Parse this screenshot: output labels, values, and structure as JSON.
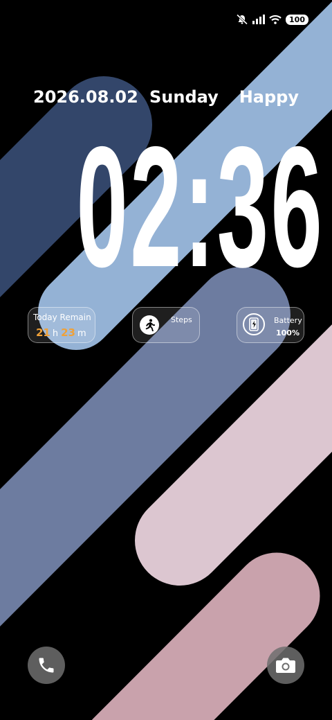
{
  "status_bar": {
    "icons": [
      "mute-bell-icon",
      "signal-icon",
      "wifi-icon"
    ],
    "battery_level": "100"
  },
  "lock_screen": {
    "date": "2026.08.02",
    "weekday": "Sunday",
    "greeting": "Happy",
    "time": "02:36"
  },
  "widgets": {
    "remain": {
      "title": "Today Remain",
      "hours": "21",
      "hours_unit": "h",
      "minutes": "23",
      "minutes_unit": "m"
    },
    "steps": {
      "label": "Steps",
      "icon": "runner-icon"
    },
    "battery": {
      "label": "Battery",
      "value": "100%",
      "icon": "phone-battery-icon"
    }
  },
  "shortcuts": {
    "left": "phone-icon",
    "right": "camera-icon"
  },
  "colors": {
    "background": "#000000",
    "accent_orange": "#f0a138",
    "stripe_navy": "#33466a",
    "stripe_light_blue": "#94b2d5",
    "stripe_slate": "#6d7ca0",
    "stripe_pale_pink": "#dcc6d0",
    "stripe_dusty_pink": "#c9a2ac"
  }
}
